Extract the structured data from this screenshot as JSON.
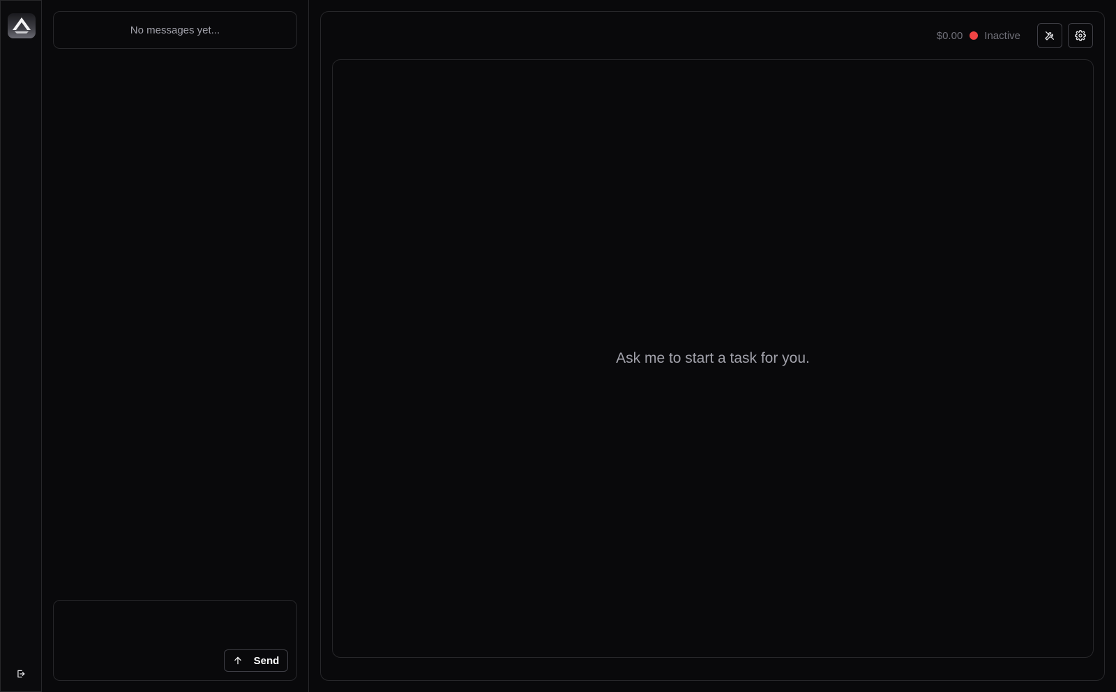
{
  "rail": {
    "logo_icon": "app-logo",
    "logout_icon": "logout-icon"
  },
  "chat": {
    "empty_state": "No messages yet...",
    "composer": {
      "placeholder": "",
      "value": "",
      "send_label": "Send",
      "send_icon": "arrow-up-icon"
    }
  },
  "main": {
    "cost": "$0.00",
    "status": {
      "label": "Inactive",
      "color": "#ef4444"
    },
    "tools_icon": "tools-icon",
    "settings_icon": "gear-icon",
    "workspace_placeholder": "Ask me to start a task for you."
  },
  "theme": {
    "background": "#09090b",
    "border": "#27272a",
    "text_muted": "#a1a1aa"
  }
}
